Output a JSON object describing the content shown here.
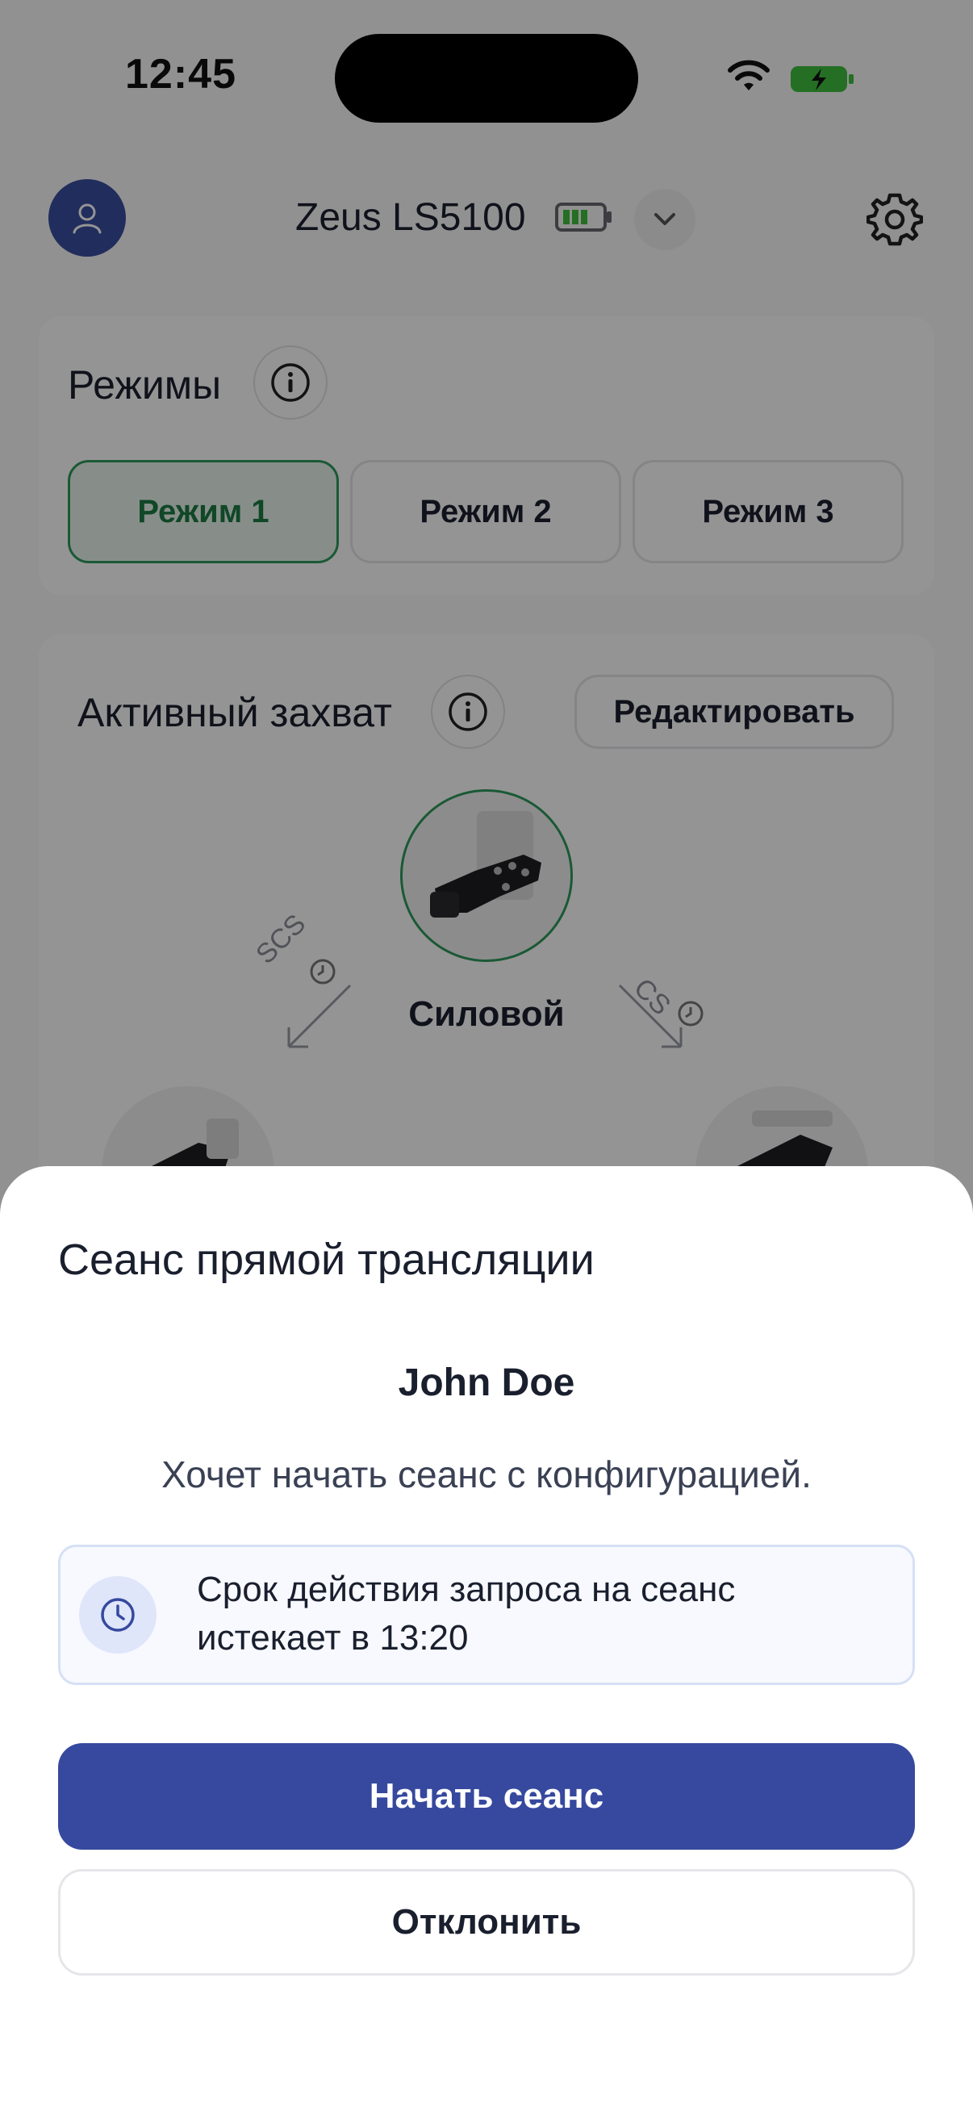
{
  "status_bar": {
    "time": "12:45"
  },
  "header": {
    "device_name": "Zeus LS5100"
  },
  "modes": {
    "title": "Режимы",
    "items": [
      {
        "label": "Режим 1",
        "active": true
      },
      {
        "label": "Режим 2",
        "active": false
      },
      {
        "label": "Режим 3",
        "active": false
      }
    ]
  },
  "active_grip": {
    "title": "Активный захват",
    "edit_label": "Редактировать",
    "current_grip": "Силовой",
    "left_transition": "SCS",
    "right_transition": "CS"
  },
  "session_sheet": {
    "title": "Сеанс прямой трансляции",
    "user_name": "John Doe",
    "description": "Хочет начать сеанс с конфигурацией.",
    "expiry_text": "Срок действия запроса на сеанс истекает в 13:20",
    "start_label": "Начать сеанс",
    "decline_label": "Отклонить"
  },
  "colors": {
    "primary": "#36499e",
    "active_green": "#2e9a5c",
    "battery_green": "#3fbf3f"
  }
}
